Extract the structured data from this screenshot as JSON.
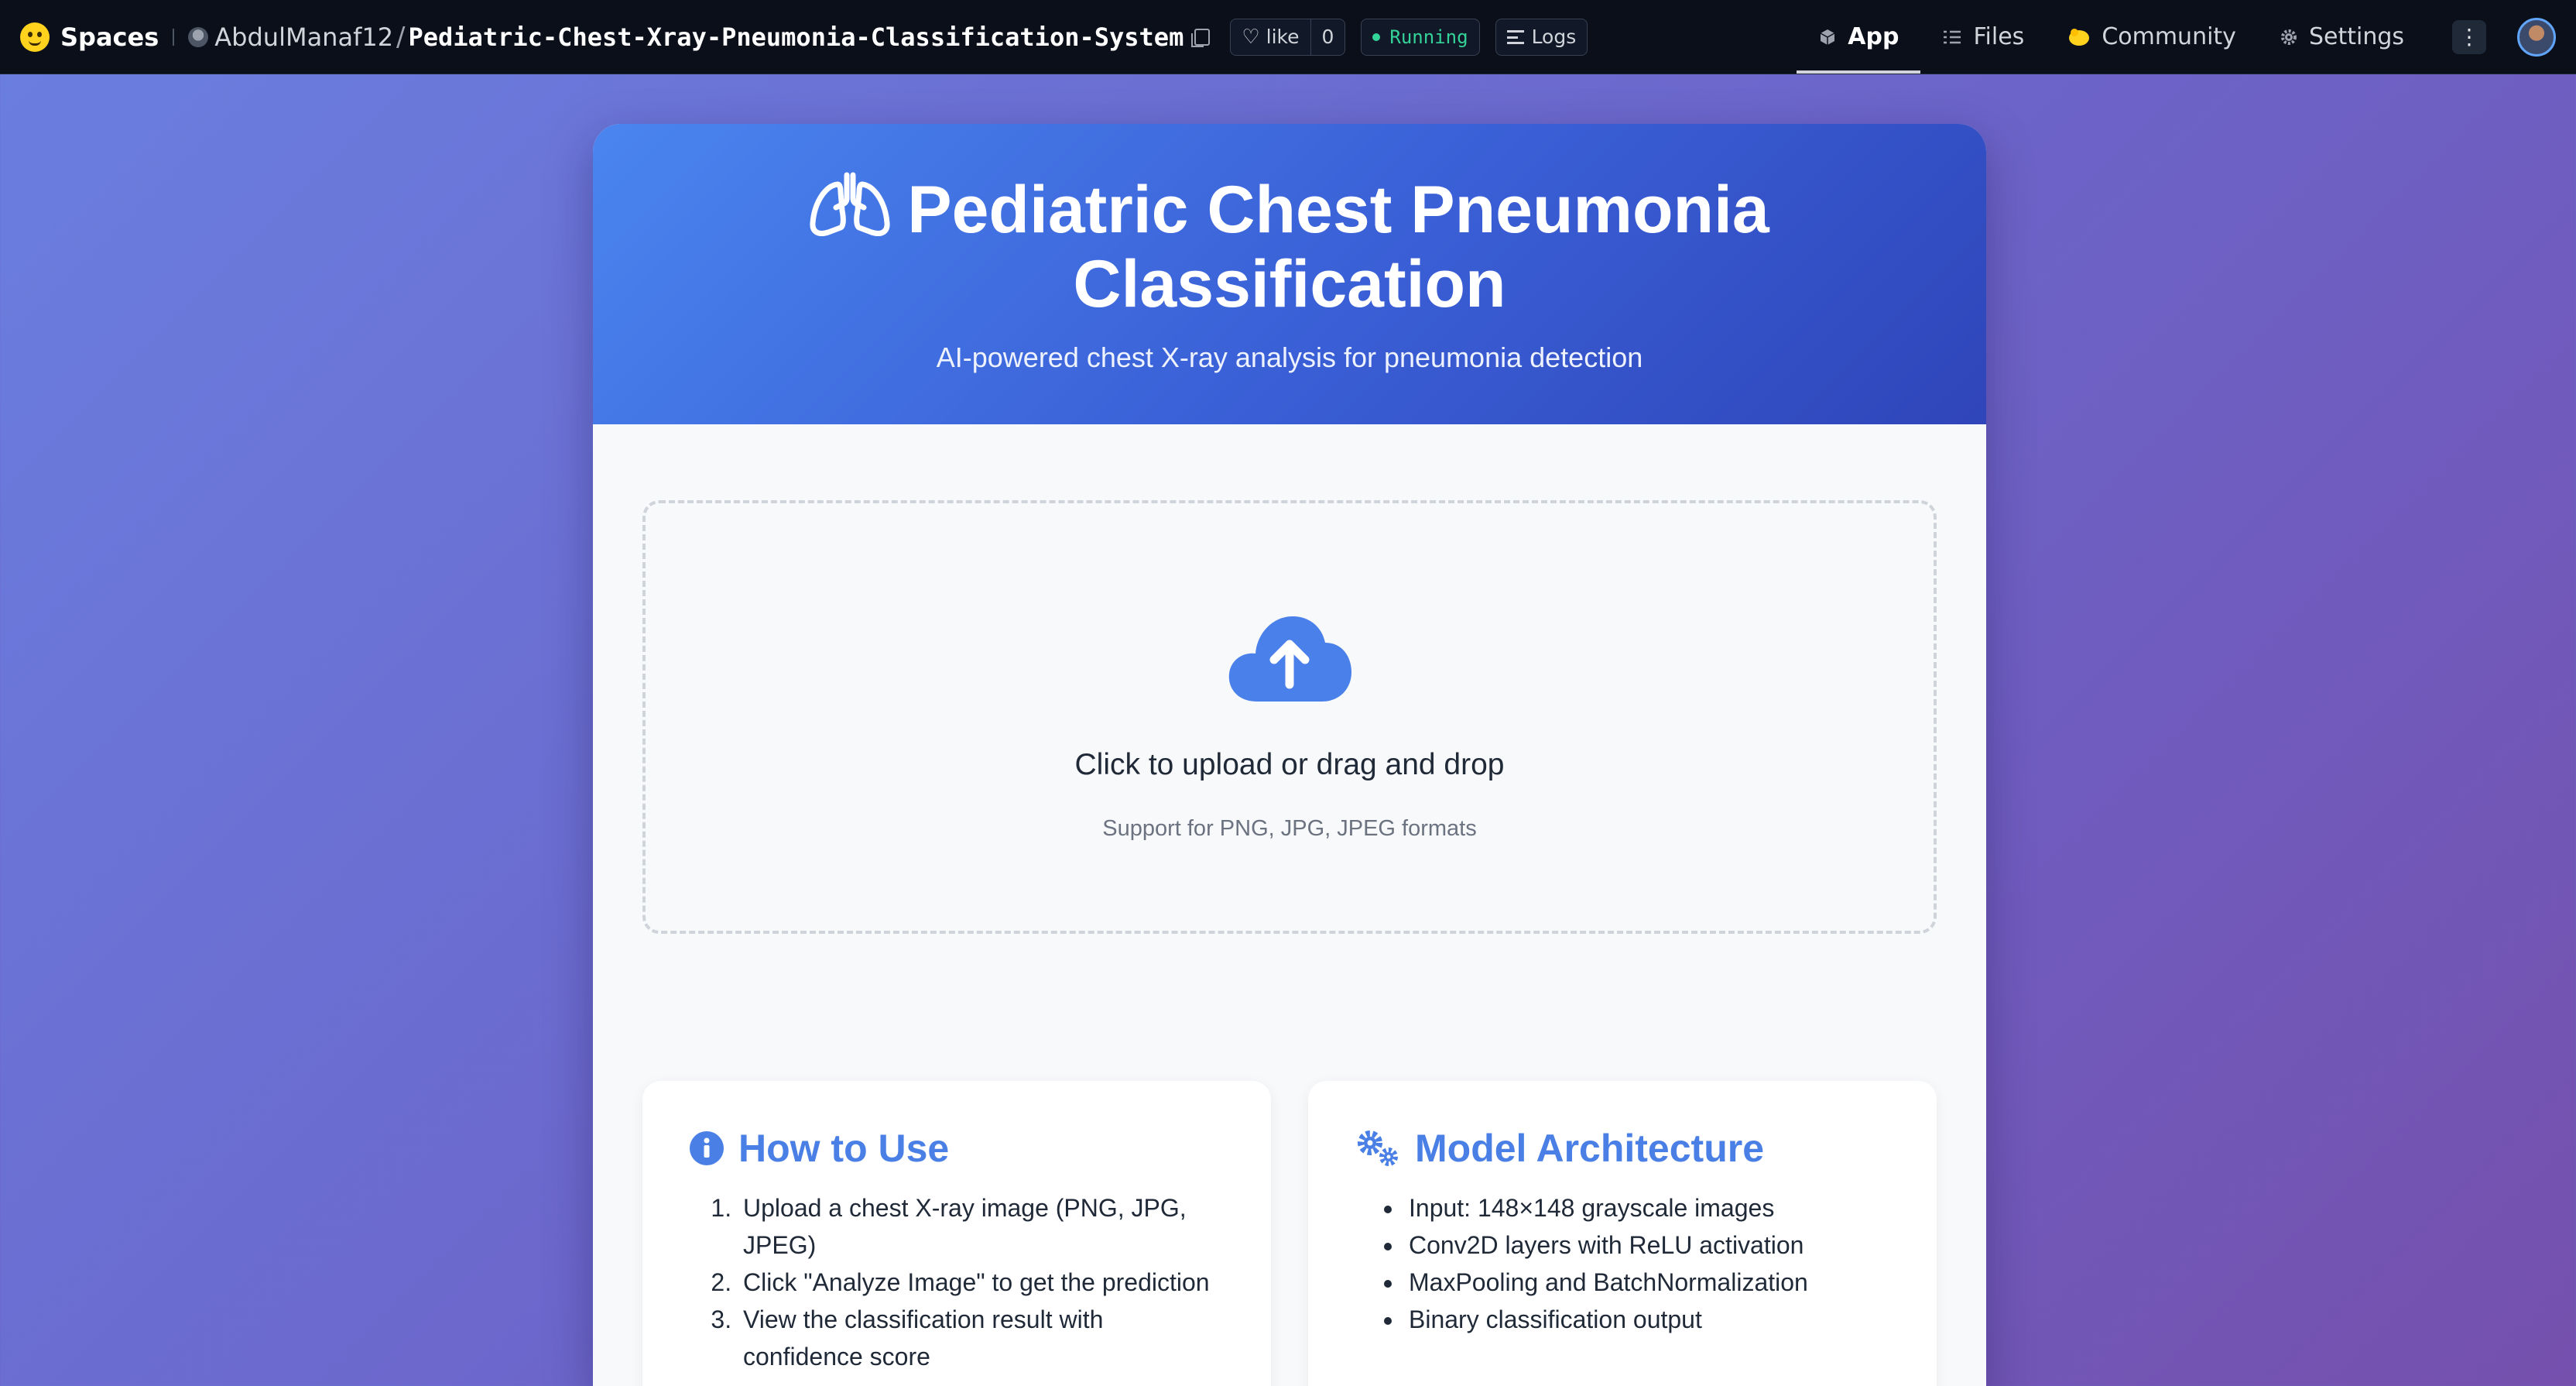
{
  "topbar": {
    "spaces_label": "Spaces",
    "owner": "AbdulManaf12",
    "separator": "/",
    "repo": "Pediatric-Chest-Xray-Pneumonia-Classification-System",
    "like_label": "like",
    "like_count": "0",
    "status": "Running",
    "logs_label": "Logs",
    "nav": {
      "app": "App",
      "files": "Files",
      "community": "Community",
      "settings": "Settings"
    },
    "kebab": "⋮"
  },
  "hero": {
    "title_line1": "Pediatric Chest Pneumonia",
    "title_line2": "Classification",
    "subtitle": "AI-powered chest X-ray analysis for pneumonia detection"
  },
  "upload": {
    "title": "Click to upload or drag and drop",
    "subtitle": "Support for PNG, JPG, JPEG formats"
  },
  "how_to_use": {
    "heading": "How to Use",
    "steps": [
      "Upload a chest X-ray image (PNG, JPG, JPEG)",
      "Click \"Analyze Image\" to get the prediction",
      "View the classification result with confidence score"
    ]
  },
  "model_architecture": {
    "heading": "Model Architecture",
    "items": [
      "Input: 148×148 grayscale images",
      "Conv2D layers with ReLU activation",
      "MaxPooling and BatchNormalization",
      "Binary classification output"
    ]
  },
  "colors": {
    "accent": "#4a7fe6",
    "hero_start": "#4a85ef",
    "hero_end": "#2f45b9",
    "running": "#34d399",
    "topbar_bg": "#0b0f19"
  },
  "icons": {
    "hf_logo": "huggingface-logo-icon",
    "lungs": "lungs-icon",
    "cloud": "cloud-upload-icon",
    "info": "info-circle-icon",
    "gears": "gears-icon"
  }
}
